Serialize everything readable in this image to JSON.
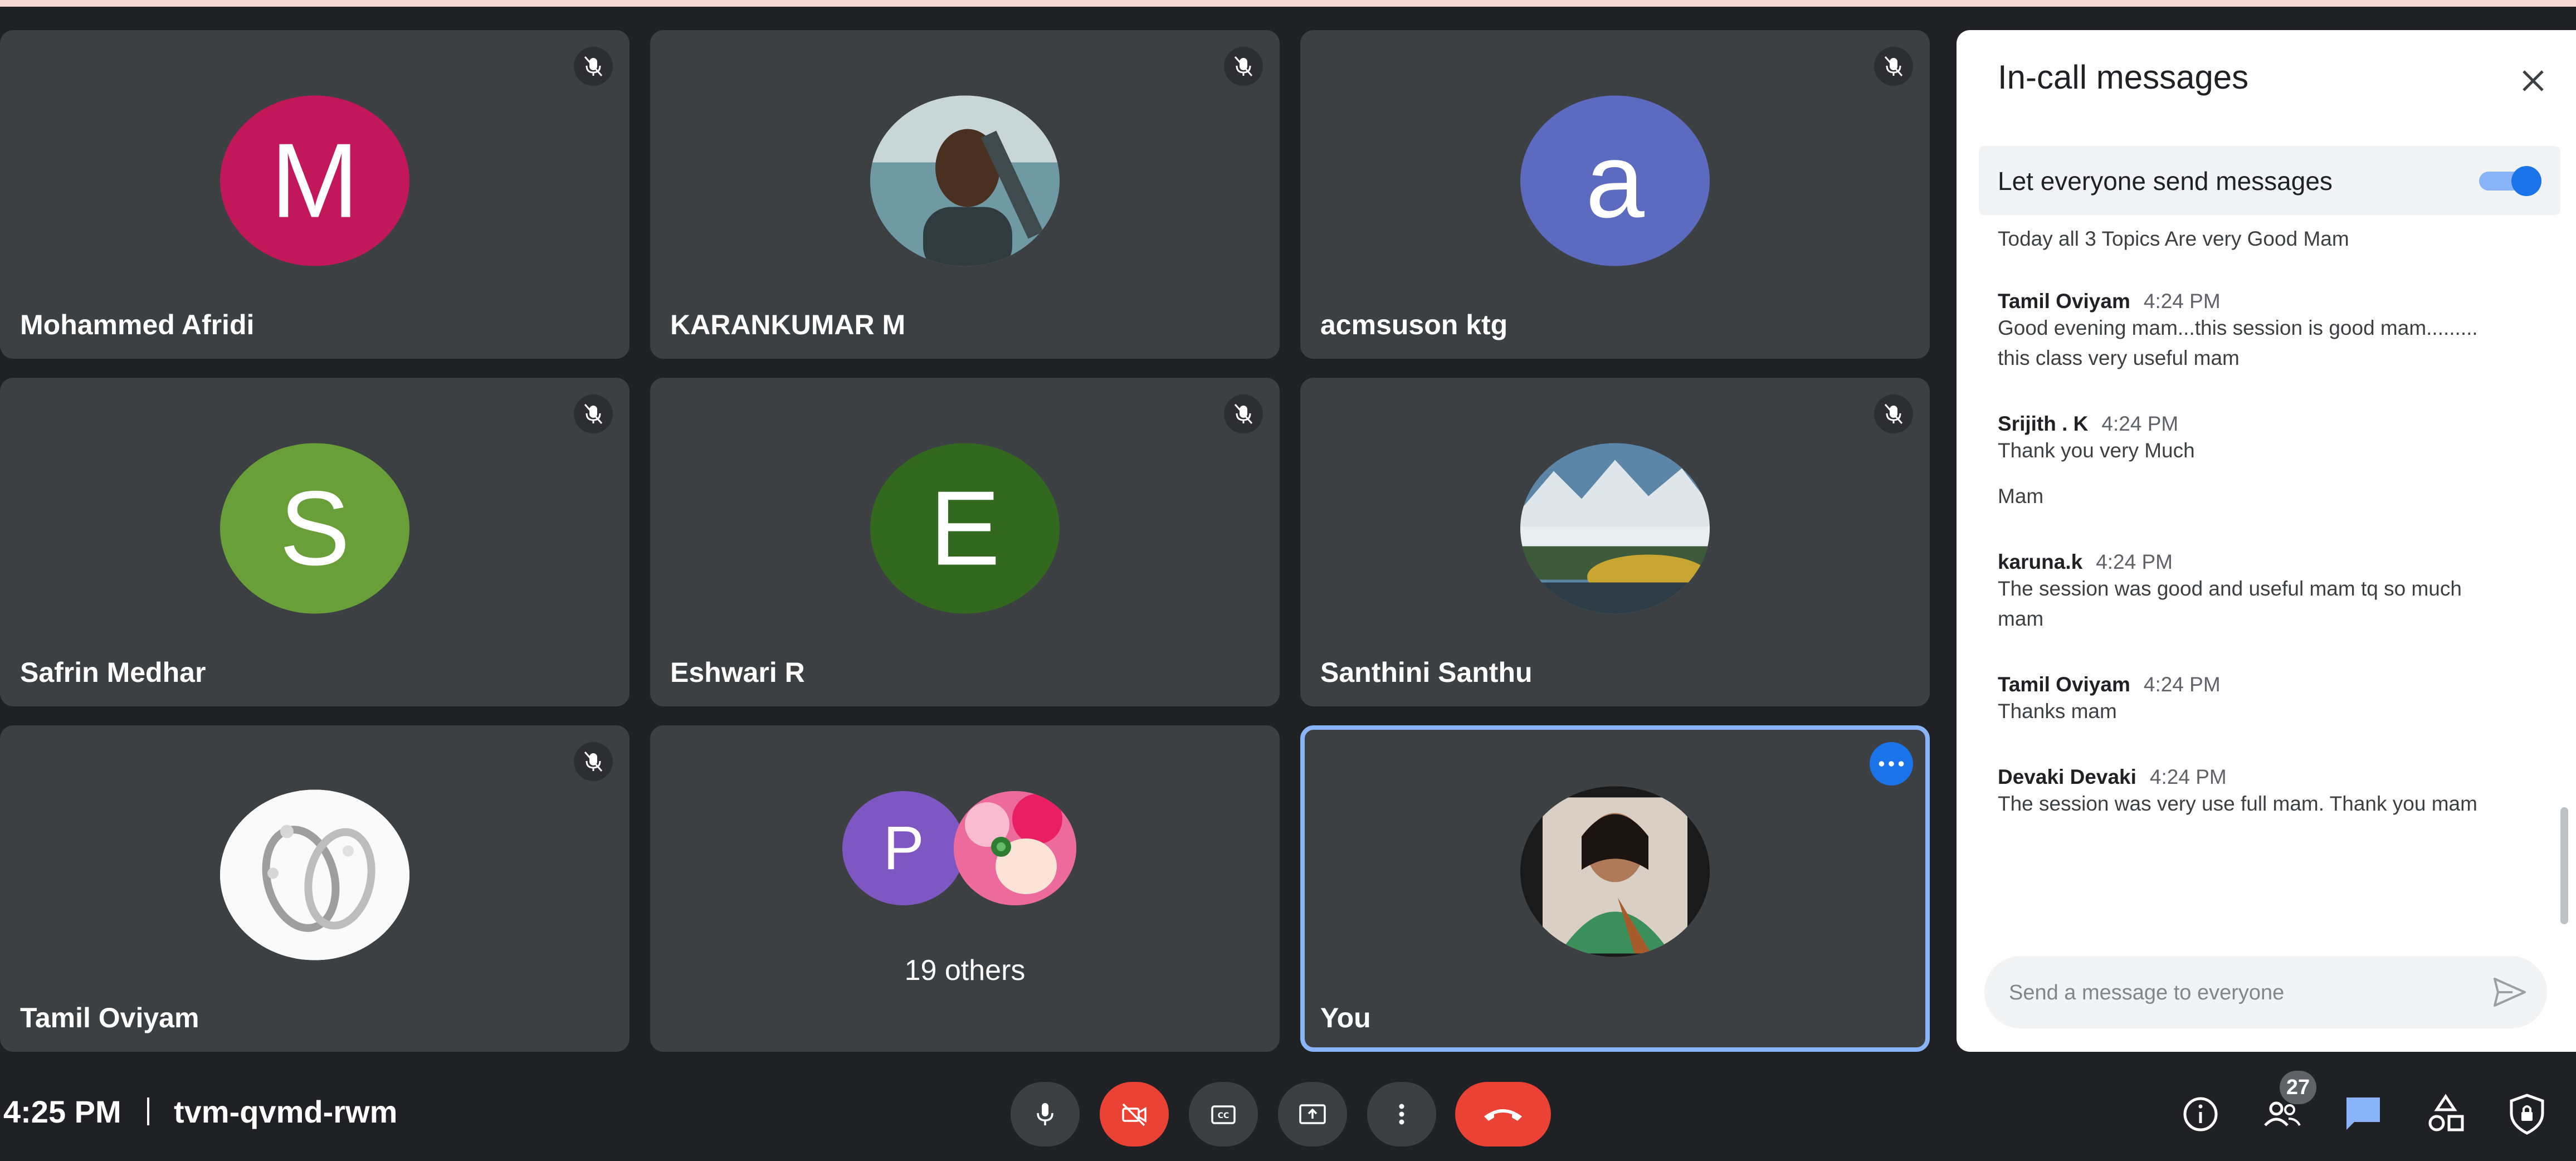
{
  "meeting": {
    "time": "4:25 PM",
    "code": "tvm-qvmd-rwm"
  },
  "tiles": [
    {
      "name": "Mohammed Afridi",
      "initial": "M",
      "color": "#c2185b"
    },
    {
      "name": "KARANKUMAR M"
    },
    {
      "name": "acmsuson ktg",
      "initial": "a",
      "color": "#5c6bc0"
    },
    {
      "name": "Safrin Medhar",
      "initial": "S",
      "color": "#689f38"
    },
    {
      "name": "Eshwari R",
      "initial": "E",
      "color": "#33691e"
    },
    {
      "name": "Santhini Santhu"
    },
    {
      "name": "Tamil Oviyam"
    },
    {
      "others_label": "19 others",
      "initial": "P",
      "color": "#7e57c2"
    },
    {
      "name": "You"
    }
  ],
  "chat": {
    "title": "In-call messages",
    "toggle_label": "Let everyone send messages",
    "toggle_on": true,
    "fragment": "Today all  3 Topics Are very Good Mam",
    "messages": [
      {
        "sender": "Tamil Oviyam",
        "time": "4:24 PM",
        "lines": [
          "Good evening mam...this session is good mam.........",
          "this class very useful mam"
        ]
      },
      {
        "sender": "Srijith . K",
        "time": "4:24 PM",
        "lines": [
          "Thank you very Much",
          "Mam"
        ]
      },
      {
        "sender": "karuna.k",
        "time": "4:24 PM",
        "lines": [
          "The session was good and useful mam tq so much",
          "mam"
        ]
      },
      {
        "sender": "Tamil Oviyam",
        "time": "4:24 PM",
        "lines": [
          "Thanks mam"
        ]
      },
      {
        "sender": "Devaki Devaki",
        "time": "4:24 PM",
        "lines": [
          "The session was very use full mam. Thank you mam"
        ]
      }
    ],
    "input_placeholder": "Send a message to everyone"
  },
  "people_count": "27",
  "colors": {
    "background": "#202124",
    "tile": "#3c4043",
    "accent": "#1a73e8",
    "danger": "#ea4335"
  },
  "icons": [
    "mic-off-icon",
    "more-horizontal-icon",
    "close-icon",
    "send-icon",
    "mic-icon",
    "camera-off-icon",
    "captions-icon",
    "present-screen-icon",
    "more-vertical-icon",
    "hang-up-icon",
    "info-icon",
    "people-icon",
    "chat-icon",
    "activities-icon",
    "host-controls-icon"
  ]
}
